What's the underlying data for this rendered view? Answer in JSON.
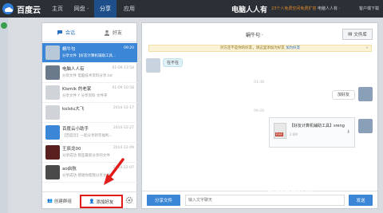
{
  "app": {
    "logo_text": "百度云",
    "brand_art": "电脑人人有",
    "promo": "23个人免费空间免费扩容",
    "user": "电脑人人有 ·",
    "client": "客户端下载"
  },
  "nav": [
    "主页",
    "网盘 ·",
    "分享",
    "应用"
  ],
  "tabs": {
    "chat": "会话",
    "friends": "好友"
  },
  "conversations": [
    {
      "name": "蜗牛句",
      "preview": "分享文件【好友计算机辅助工具...",
      "time": "09:20",
      "active": true
    },
    {
      "name": "电脑人人有",
      "preview": "分享文件 电脑技术资料分享.txt",
      "time": "01-09 13:58"
    },
    {
      "name": "Kismik 的老家",
      "preview": "分享文件 Y 分享资料 文件夹",
      "time": "01-09 10:58"
    },
    {
      "name": "kolstu大飞",
      "preview": "",
      "time": "2014-12-17"
    },
    {
      "name": "百度云小助手",
      "preview": "【百度云】一起分享新年福利...",
      "time": "2014-12-27"
    },
    {
      "name": "王辰龙00",
      "preview": "分享成功 我是最新分享的文件",
      "time": "2014-12-09"
    },
    {
      "name": "ao启航",
      "preview": "分享成功 感谢你帮我分享文件",
      "time": "2014-12-07"
    }
  ],
  "bottom": {
    "create_group": "创建群组",
    "add_friend": "添加好友"
  },
  "chat": {
    "title": "蜗牛句 ·",
    "files_button": "文件库",
    "notice_text": "对方还不是你的好友，请这里添加为好友",
    "notice_link": "加为好友",
    "messages": [
      {
        "text": "在不在"
      },
      {
        "time": "01:38"
      },
      {
        "text": "加好友"
      },
      {
        "time": "09:20"
      }
    ],
    "file": {
      "name": "【好友计算机辅助工具】sreng",
      "size": "2.6M",
      "type": "RAR"
    },
    "share_button": "分享文件",
    "input_placeholder": "输入文字聊天",
    "send_button": "发送"
  },
  "watermark": "Baidu经验",
  "colors": {
    "accent": "#3b86d6",
    "topbar": "#2b2f36",
    "highlight": "#e21b1b"
  }
}
